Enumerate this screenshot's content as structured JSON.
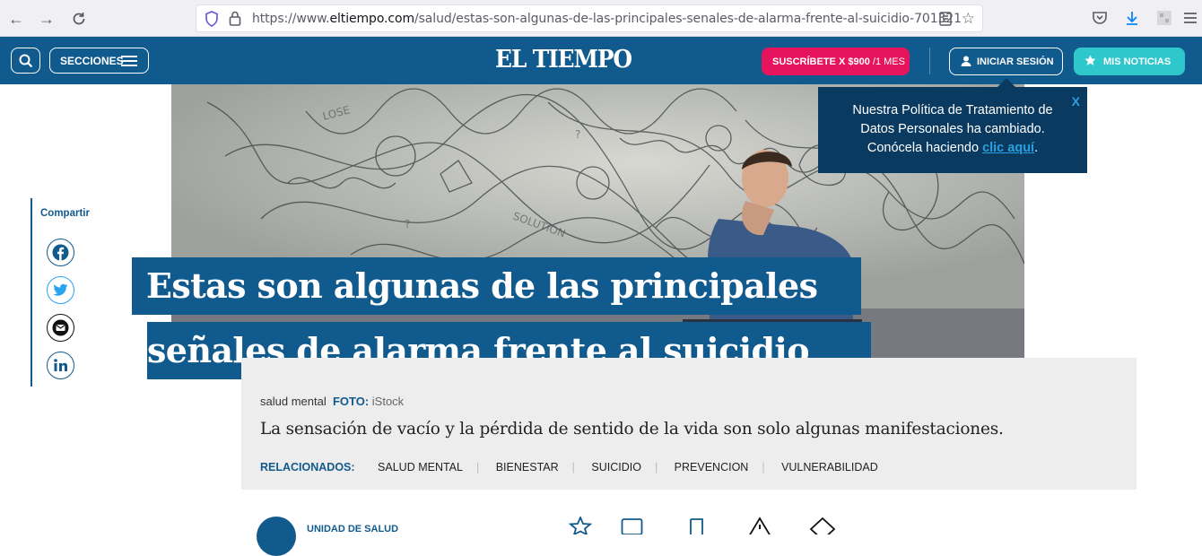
{
  "browser": {
    "url_prefix": "https://www.",
    "url_domain": "eltiempo.com",
    "url_path": "/salud/estas-son-algunas-de-las-principales-senales-de-alarma-frente-al-suicidio-701321"
  },
  "header": {
    "sections_label": "SECCIONES",
    "logo": "EL TIEMPO",
    "subscribe_bold": "SUSCRÍBETE X $900",
    "subscribe_rest": " /1 MES",
    "login_label": "INICIAR SESIÓN",
    "my_news_label": "MIS NOTICIAS",
    "brand_color": "#115a8d",
    "subscribe_color": "#e5145c",
    "my_news_color": "#2ec8cc"
  },
  "popup": {
    "close_label": "X",
    "line1": "Nuestra Política de Tratamiento de",
    "line2": "Datos Personales ha cambiado.",
    "line3_prefix": "Conócela haciendo ",
    "link_label": "clic aquí",
    "line3_suffix": "."
  },
  "share": {
    "label": "Compartir",
    "icons": [
      "facebook-icon",
      "twitter-icon",
      "email-icon",
      "linkedin-icon"
    ]
  },
  "article": {
    "headline_line1": "Estas son algunas de las principales",
    "headline_line2": "señales de alarma frente al suicidio",
    "photo_caption": "salud mental",
    "photo_label": "FOTO:",
    "photo_source": "iStock",
    "summary": "La sensación de vacío y la pérdida de sentido de la vida son solo algunas manifestaciones.",
    "related_label": "RELACIONADOS:",
    "related_tags": [
      "SALUD MENTAL",
      "BIENESTAR",
      "SUICIDIO",
      "PREVENCION",
      "VULNERABILIDAD"
    ],
    "author_unit": "UNIDAD DE SALUD"
  }
}
